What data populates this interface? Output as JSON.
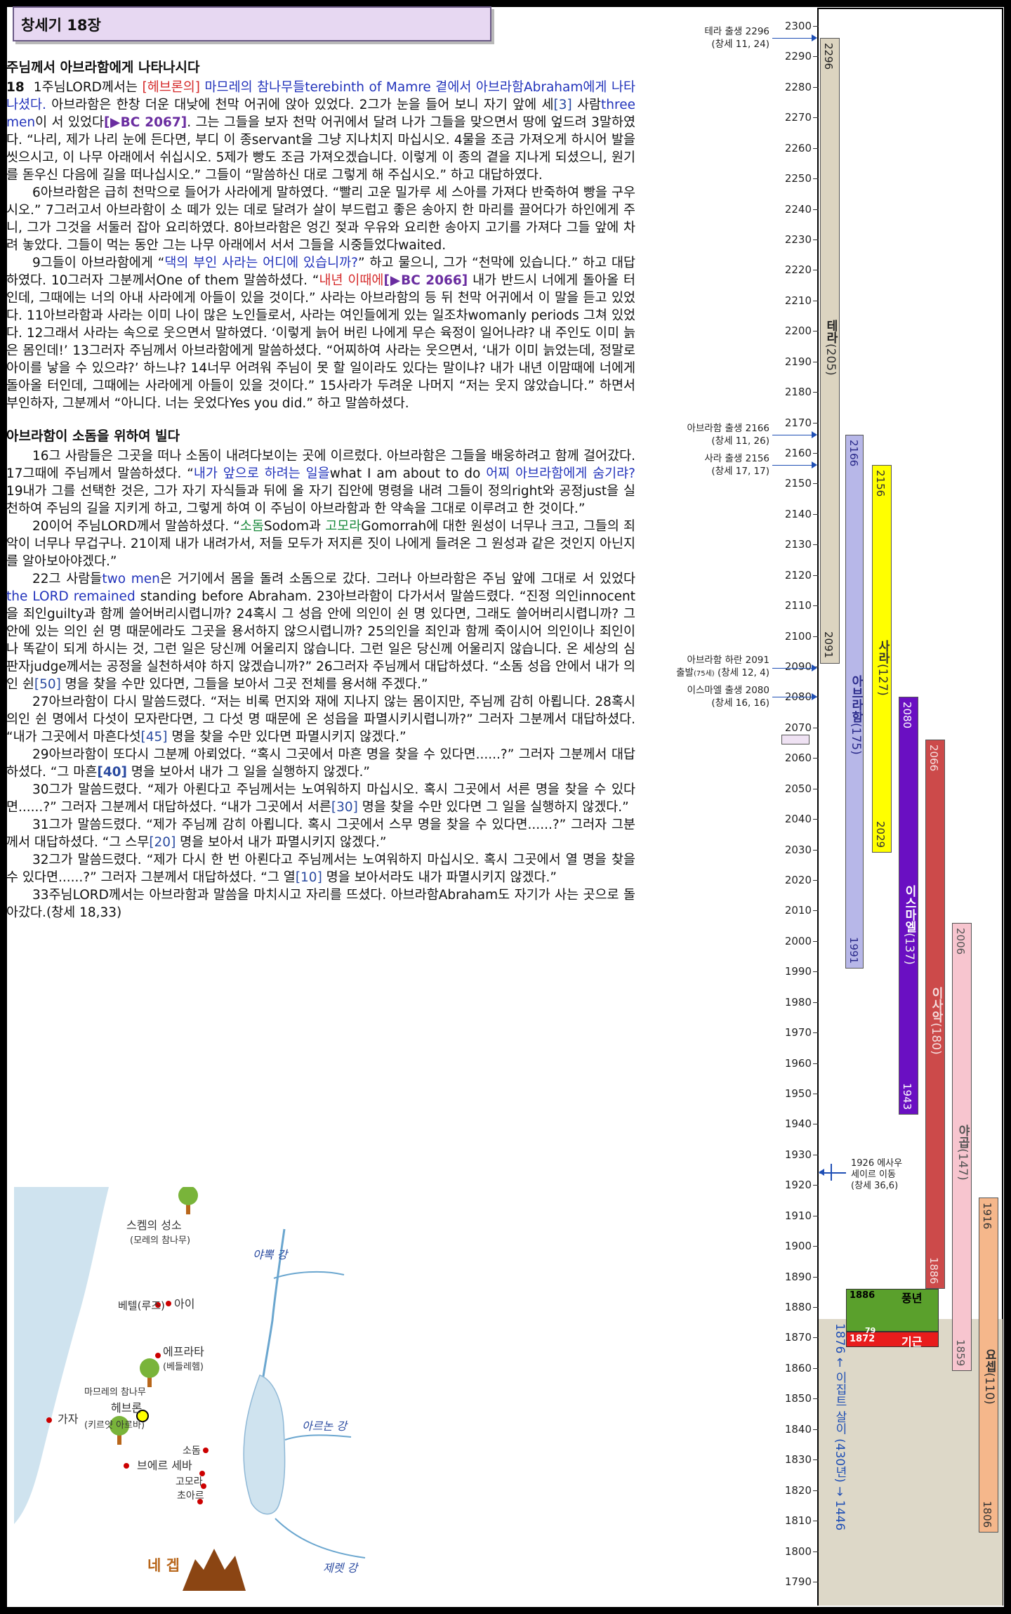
{
  "header": {
    "title": "창세기 18장"
  },
  "section1": {
    "title": "주님께서 아브라함에게 나타나시다"
  },
  "section2": {
    "title": "아브라함이 소돔을 위하여 빌다"
  },
  "p1": {
    "chap": "18",
    "a": "1주님LORD께서는 ",
    "b": "[헤브론의]",
    "c": " 마므레의 참나무들terebinth of Mamre 곁에서 아브라함Abraham에게 나타나셨다.",
    "d": " 아브라함은 한창 더운 대낮에 천막 어귀에 앉아 있었다. 2그가 눈을 들어 보니 자기 앞에 세",
    "e": "[3]",
    "f": " 사람",
    "g": "three men",
    "h": "이 서 있었다",
    "i": "[▶BC 2067]",
    "j": ". 그는 그들을 보자 천막 어귀에서 달려 나가 그들을 맞으면서 땅에 엎드려 3말하였다. “나리, 제가 나리 눈에 든다면, 부디 이 종servant을 그냥 지나치지 마십시오. 4물을 조금 가져오게 하시어 발을 씻으시고, 이 나무 아래에서 쉬십시오. 5제가 빵도 조금 가져오겠습니다. 이렇게 이 종의 곁을 지나게 되셨으니, 원기를 돋우신 다음에 길을 떠나십시오.” 그들이 “말씀하신 대로 그렇게 해 주십시오.” 하고 대답하였다."
  },
  "p2": "6아브라함은 급히 천막으로 들어가 사라에게 말하였다. “빨리 고운 밀가루 세 스아를 가져다 반죽하여 빵을 구우시오.” 7그러고서 아브라함이 소 떼가 있는 데로 달려가 살이 부드럽고 좋은 송아지 한 마리를 끌어다가 하인에게 주니, 그가 그것을 서둘러 잡아 요리하였다. 8아브라함은 엉긴 젖과 우유와 요리한 송아지 고기를 가져다 그들 앞에 차려 놓았다. 그들이 먹는 동안 그는 나무 아래에서 서서 그들을 시중들었다waited.",
  "p3": {
    "a": "9그들이 아브라함에게 “",
    "b": "댁의 부인 사라는 어디에 있습니까?",
    "c": "” 하고 물으니, 그가 “천막에 있습니다.” 하고 대답하였다. 10그러자 그분께서One of them 말씀하셨다. “",
    "d": "내년 이때에",
    "e": "[▶BC 2066]",
    "f": " 내가 반드시 너에게 돌아올 터인데, 그때에는 너의 아내 사라에게 아들이 있을 것이다.” 사라는 아브라함의 등 뒤 천막 어귀에서 이 말을 듣고 있었다. 11아브라함과 사라는 이미 나이 많은 노인들로서, 사라는 여인들에게 있는 일조차womanly periods 그쳐 있었다. 12그래서 사라는 속으로 웃으면서 말하였다. ‘이렇게 늙어 버린 나에게 무슨 육정이 일어나랴? 내 주인도 이미 늙은 몸인데!’ 13그러자 주님께서 아브라함에게 말씀하셨다. “어찌하여 사라는 웃으면서, ‘내가 이미 늙었는데, 정말로 아이를 낳을 수 있으랴?’ 하느냐? 14너무 어려워 주님이 못 할 일이라도 있다는 말이냐? 내가 내년 이맘때에 너에게 돌아올 터인데, 그때에는 사라에게 아들이 있을 것이다.” 15사라가 두려운 나머지 “저는 웃지 않았습니다.” 하면서 부인하자, 그분께서 “아니다. 너는 웃었다Yes you did.” 하고 말씀하셨다."
  },
  "p4": {
    "a": "16그 사람들은 그곳을 떠나 소돔이 내려다보이는 곳에 이르렀다. 아브라함은 그들을 배웅하려고 함께 걸어갔다. 17그때에 주님께서 말씀하셨다. “",
    "b": "내가 앞으로 하려는 일을",
    "c": "what I am about to do ",
    "d": "어찌 아브라함에게 숨기랴?",
    "e": " 19내가 그를 선택한 것은, 그가 자기 자식들과 뒤에 올 자기 집안에 명령을 내려 그들이 정의right와 공정just을 실천하여 주님의 길을 지키게 하고, 그렇게 하여 이 주님이 아브라함과 한 약속을 그대로 이루려고 한 것이다.”"
  },
  "p5": {
    "a": "20이어 주님LORD께서 말씀하셨다. “",
    "b": "소돔",
    "c": "Sodom과 ",
    "d": "고모라",
    "e": "Gomorrah에 대한 원성이 너무나 크고, 그들의 죄악이 너무나 무겁구나. 21이제 내가 내려가서, 저들 모두가 저지른 짓이 나에게 들려온 그 원성과 같은 것인지 아닌지를 알아보아야겠다.”"
  },
  "p6": {
    "a": "22그 사람들",
    "b": "two men",
    "c": "은 거기에서 몸을 돌려 소돔으로 갔다. 그러나 아브라함은 주님 앞에 그대로 서 있었다",
    "d": "the LORD remained",
    "e": " standing before Abraham. 23아브라함이 다가서서 말씀드렸다. “진정 의인innocent을 죄인guilty과 함께 쓸어버리시렵니까? 24혹시 그 성읍 안에 의인이 쉰 명 있다면, 그래도 쓸어버리시렵니까? 그 안에 있는 의인 쉰 명 때문에라도 그곳을 용서하지 않으시렵니까? 25의인을 죄인과 함께 죽이시어 의인이나 죄인이나 똑같이 되게 하시는 것, 그런 일은 당신께 어울리지 않습니다. 그런 일은 당신께 어울리지 않습니다. 온 세상의 심판자judge께서는 공정을 실천하셔야 하지 않겠습니까?” 26그러자 주님께서 대답하셨다. “소돔 성읍 안에서 내가 의인 쉰",
    "f": "[50]",
    "g": " 명을 찾을 수만 있다면, 그들을 보아서 그곳 전체를 용서해 주겠다.”"
  },
  "p7": {
    "a": "27아브라함이 다시 말씀드렸다. “저는 비록 먼지와 재에 지나지 않는 몸이지만, 주님께 감히 아룁니다. 28혹시 의인 쉰 명에서 다섯이 모자란다면, 그 다섯 명 때문에 온 성읍을 파멸시키시렵니까?” 그러자 그분께서 대답하셨다. “내가 그곳에서 마흔다섯",
    "b": "[45]",
    "c": " 명을 찾을 수만 있다면 파멸시키지 않겠다.”"
  },
  "p8": {
    "a": "29아브라함이 또다시 그분께 아뢰었다. “혹시 그곳에서 마흔 명을 찾을 수 있다면......?” 그러자 그분께서 대답하셨다. “그 마흔",
    "b": "[40]",
    "c": " 명을 보아서 내가 그 일을 실행하지 않겠다.”"
  },
  "p9": {
    "a": "30그가 말씀드렸다. “제가 아뢴다고 주님께서는 노여워하지 마십시오. 혹시 그곳에서 서른 명을 찾을 수 있다면......?” 그러자 그분께서 대답하셨다. “내가 그곳에서 서른",
    "b": "[30]",
    "c": " 명을 찾을 수만 있다면 그 일을 실행하지 않겠다.”"
  },
  "p10": {
    "a": "31그가 말씀드렸다. “제가 주님께 감히 아룁니다. 혹시 그곳에서 스무 명을 찾을 수 있다면......?” 그러자 그분께서 대답하셨다. “그 스무",
    "b": "[20]",
    "c": " 명을 보아서 내가 파멸시키지 않겠다.”"
  },
  "p11": {
    "a": "32그가 말씀드렸다. “제가 다시 한 번 아뢴다고 주님께서는 노여워하지 마십시오. 혹시 그곳에서 열 명을 찾을 수 있다면......?” 그러자 그분께서 대답하셨다. “그 열",
    "b": "[10]",
    "c": " 명을 보아서라도 내가 파멸시키지 않겠다.”"
  },
  "p12": "33주님LORD께서는 아브라함과 말씀을 마치시고 자리를 뜨셨다. 아브라함Abraham도 자기가 사는 곳으로 돌아갔다.(창세 18,33)",
  "map": {
    "shechem": "스켐의 성소",
    "shechem_sub": "(모레의 참나무)",
    "jabbok": "야뽁 강",
    "bethel": "베텔(루즈)",
    "ai": "아이",
    "ephrath": "에프라타",
    "ephrath_sub": "(베들레헴)",
    "mamre": "마므레의 참나무",
    "hebron": "헤브론",
    "hebron_sub": "(키르얏 아르바)",
    "gaza": "가자",
    "arnon": "아르논 강",
    "sodom": "소돔",
    "gomorrah": "고모라",
    "zoar": "초아르",
    "beersheba": "브에르 세바",
    "negeb": "네 겝",
    "zered": "제렛 강"
  },
  "timeline": {
    "ticks": [
      "2300",
      "2290",
      "2280",
      "2270",
      "2260",
      "2250",
      "2240",
      "2230",
      "2220",
      "2210",
      "2200",
      "2190",
      "2180",
      "2170",
      "2160",
      "2150",
      "2140",
      "2130",
      "2120",
      "2110",
      "2100",
      "2090",
      "2080",
      "2070",
      "2060",
      "2050",
      "2040",
      "2030",
      "2020",
      "2010",
      "2000",
      "1990",
      "1980",
      "1970",
      "1960",
      "1950",
      "1940",
      "1930",
      "1920",
      "1910",
      "1900",
      "1890",
      "1880",
      "1870",
      "1860",
      "1850",
      "1840",
      "1830",
      "1820",
      "1810",
      "1800",
      "1790"
    ],
    "terah": {
      "name": "테라",
      "age": "(205)",
      "start": "2296",
      "end": "2091",
      "color": "#dcd4c0"
    },
    "abraham": {
      "name": "아브라함",
      "age": "(175)",
      "start": "2166",
      "end": "1991",
      "color": "#b7b7e8"
    },
    "sarah": {
      "name": "사라",
      "age": "(127)",
      "start": "2156",
      "end": "2029",
      "color": "#ffff00"
    },
    "ishmael": {
      "name": "이스마엘",
      "age": "(137)",
      "start": "2080",
      "end": "1943",
      "color": "#6a0fc2"
    },
    "isaac": {
      "name": "이사악",
      "age": "(180)",
      "start": "2066",
      "end": "1886",
      "color": "#cc4a4a"
    },
    "jacob": {
      "name": "야곱",
      "age": "(147)",
      "start": "2006",
      "end": "1859",
      "color": "#f7c5cf"
    },
    "joseph": {
      "name": "요셉",
      "age": "(110)",
      "start": "1916",
      "end": "1806",
      "color": "#f5b78b"
    },
    "ann_terah": {
      "l1": "테라 출생",
      "y1": "2296",
      "l2": "(창세 11, 24)"
    },
    "ann_abraham": {
      "l1": "아브라함 출생 2166",
      "l2": "(창세 11, 26)"
    },
    "ann_sarah": {
      "l1": "사라 출생",
      "y1": "2156",
      "l2": "(창세 17, 17)"
    },
    "ann_haran": {
      "l1": "아브라함 하란",
      "y1": "2091",
      "l2": "출발",
      "l2s": "(75세)",
      "l3": "(창세 12, 4)"
    },
    "ann_ishmael": {
      "l1": "이스마엘 출생",
      "y1": "2080",
      "l2": "(창세 16, 16)"
    },
    "ann_esau": {
      "l1": "1926 에사우",
      "l2": "세이르 이동",
      "l3": "(창세 36,6)"
    },
    "plenty": {
      "year": "1886",
      "label": "풍년",
      "color": "#5aa02c"
    },
    "famine": {
      "year": "1872",
      "label": "기근",
      "dur": "79",
      "color": "#e81c1c"
    },
    "egypt": {
      "text": "1876 ← 이집트 살이 (430년) → 1446"
    }
  }
}
